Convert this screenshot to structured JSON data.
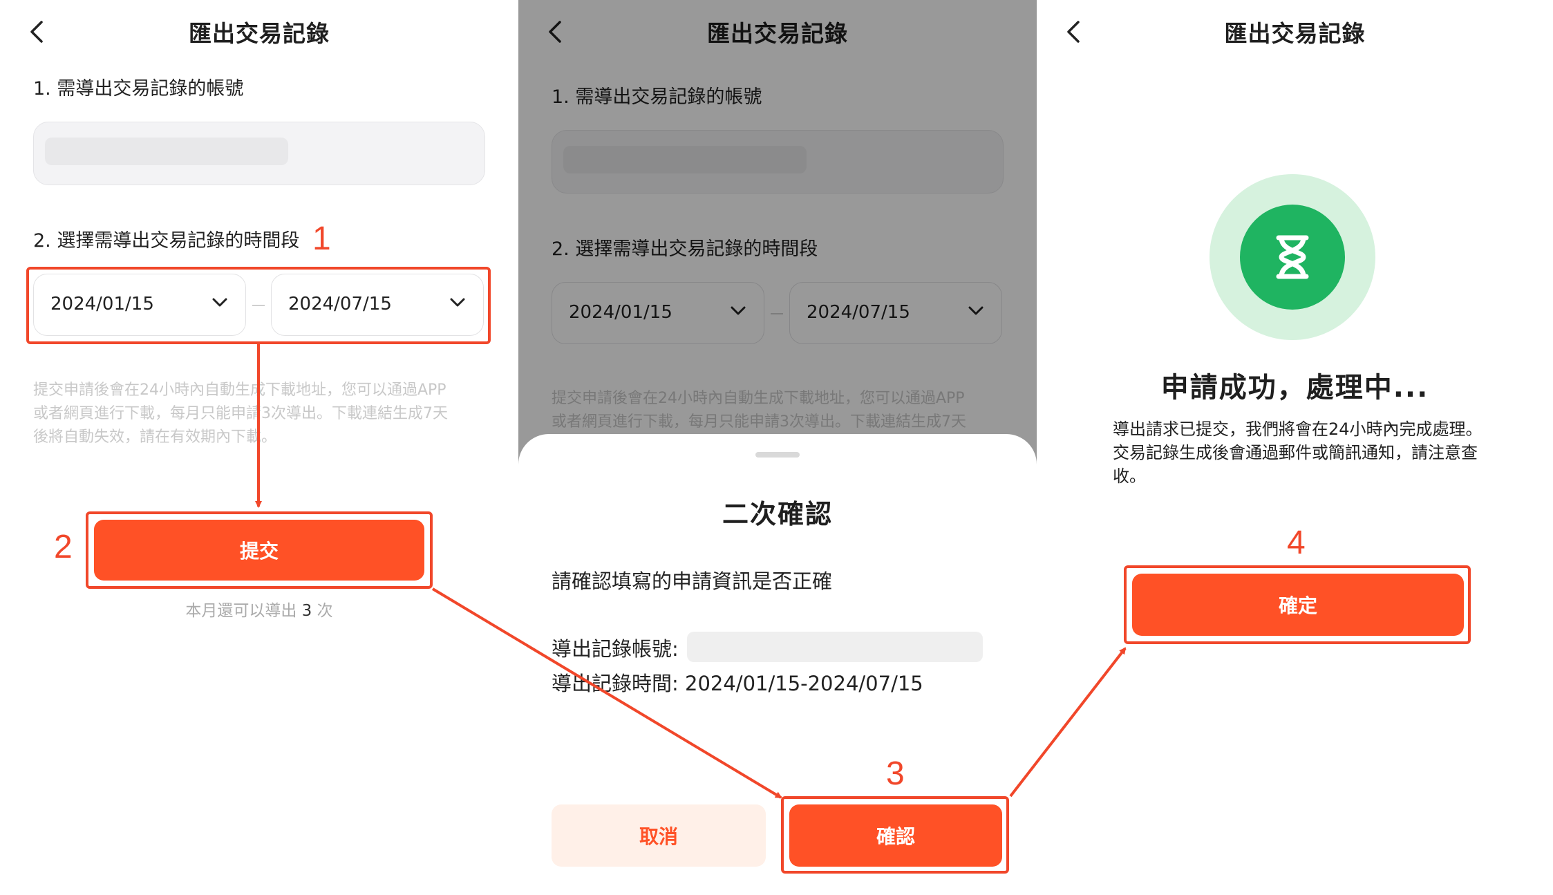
{
  "screen1": {
    "title": "匯出交易記錄",
    "label_account": "1. 需導出交易記錄的帳號",
    "label_period": "2. 選擇需導出交易記錄的時間段",
    "date_from": "2024/01/15",
    "date_to": "2024/07/15",
    "hint_lines": [
      "提交申請後會在24小時內自動生成下載地址，您可以通過APP",
      "或者網頁進行下載，每月只能申請3次導出。下載連結生成7天",
      "後將自動失效，請在有效期內下載。"
    ],
    "submit_label": "提交",
    "remaining_prefix": "本月還可以導出",
    "remaining_count": "3",
    "remaining_suffix": "次"
  },
  "screen2": {
    "title": "匯出交易記錄",
    "label_account": "1. 需導出交易記錄的帳號",
    "label_period": "2. 選擇需導出交易記錄的時間段",
    "date_from": "2024/01/15",
    "date_to": "2024/07/15",
    "hint_lines": [
      "提交申請後會在24小時內自動生成下載地址，您可以通過APP",
      "或者網頁進行下載，每月只能申請3次導出。下載連結生成7天"
    ],
    "dialog": {
      "title": "二次確認",
      "question": "請確認填寫的申請資訊是否正確",
      "account_label": "導出記錄帳號:",
      "period_label": "導出記錄時間:",
      "period_value": "2024/01/15-2024/07/15",
      "cancel_label": "取消",
      "confirm_label": "確認"
    }
  },
  "screen3": {
    "title": "匯出交易記錄",
    "status_title": "申請成功，處理中...",
    "desc_lines": [
      "導出請求已提交，我們將會在24小時內完成處理。",
      "交易記錄生成後會通過郵件或簡訊通知，請注意查",
      "收。"
    ],
    "ok_label": "確定"
  },
  "steps": [
    "1",
    "2",
    "3",
    "4"
  ],
  "colors": {
    "accent": "#ff5126",
    "annotation": "#f1472a",
    "success": "#1fb461",
    "success_ring": "#d6f2de"
  },
  "icons": [
    "back-arrow-icon",
    "chevron-down-icon",
    "hourglass-icon"
  ]
}
